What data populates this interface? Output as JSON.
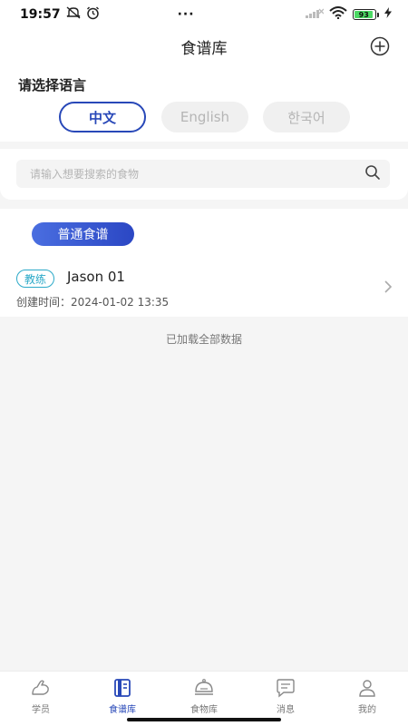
{
  "status": {
    "time": "19:57",
    "battery": "93"
  },
  "header": {
    "title": "食谱库"
  },
  "language": {
    "title": "请选择语言",
    "options": [
      "中文",
      "English",
      "한국어"
    ]
  },
  "search": {
    "placeholder": "请输入想要搜索的食物"
  },
  "category": {
    "label": "普通食谱"
  },
  "recipes": [
    {
      "badge": "教练",
      "name": "Jason 01",
      "created_label": "创建时间：",
      "created_time": "2024-01-02 13:35"
    }
  ],
  "list_end": "已加载全部数据",
  "tabs": [
    {
      "label": "学员",
      "icon": "arm-icon"
    },
    {
      "label": "食谱库",
      "icon": "book-icon"
    },
    {
      "label": "食物库",
      "icon": "food-dome-icon"
    },
    {
      "label": "消息",
      "icon": "message-icon"
    },
    {
      "label": "我的",
      "icon": "profile-icon"
    }
  ],
  "colors": {
    "accent": "#2848b8",
    "badge": "#2ba9c8",
    "battery": "#4cd964"
  }
}
